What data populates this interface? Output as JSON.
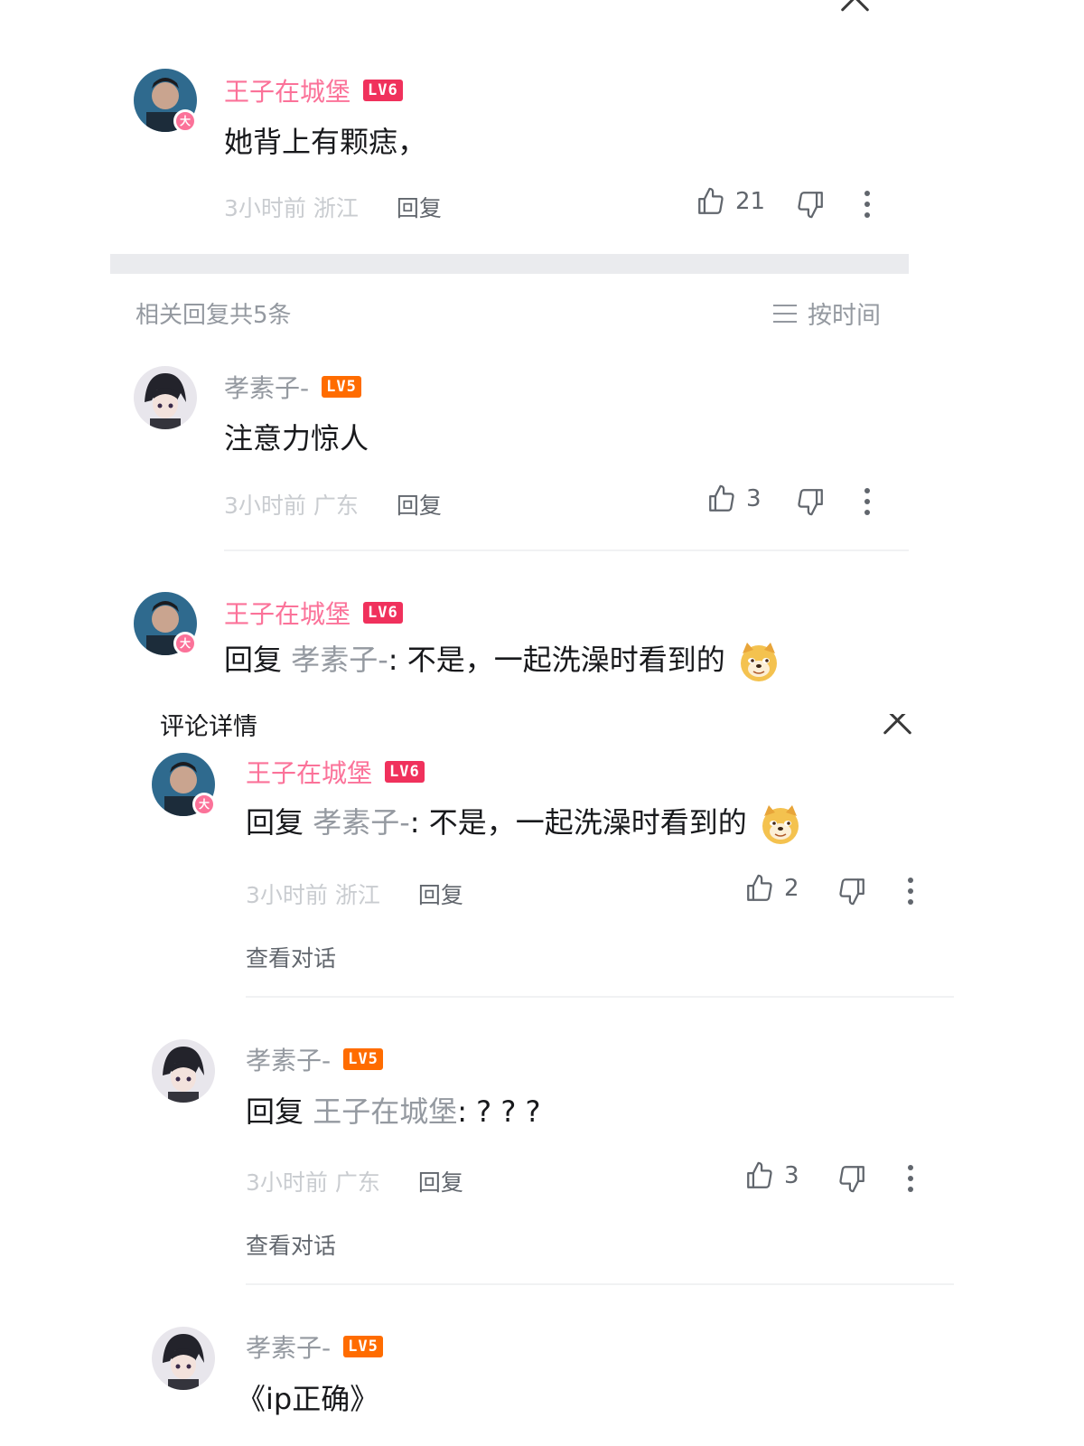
{
  "top_panel": {
    "main_comment": {
      "username": "王子在城堡",
      "level": "LV6",
      "text": "她背上有颗痣，",
      "time": "3小时前",
      "location": "浙江",
      "reply_label": "回复",
      "likes": "21"
    },
    "replies_header": {
      "count_text": "相关回复共5条",
      "sort_label": "按时间"
    },
    "replies": [
      {
        "username": "孝素子-",
        "level": "LV5",
        "text": "注意力惊人",
        "time": "3小时前",
        "location": "广东",
        "reply_label": "回复",
        "likes": "3"
      },
      {
        "username": "王子在城堡",
        "level": "LV6",
        "reply_kw": "回复",
        "at_user": "孝素子-",
        "text": ": 不是，一起洗澡时看到的"
      }
    ]
  },
  "bottom_panel": {
    "title": "评论详情",
    "comments": [
      {
        "username": "王子在城堡",
        "level": "LV6",
        "reply_kw": "回复",
        "at_user": "孝素子-",
        "text": ": 不是，一起洗澡时看到的",
        "time": "3小时前",
        "location": "浙江",
        "reply_label": "回复",
        "likes": "2",
        "view_convo": "查看对话"
      },
      {
        "username": "孝素子-",
        "level": "LV5",
        "reply_kw": "回复",
        "at_user": "王子在城堡",
        "text": ": ? ? ?",
        "time": "3小时前",
        "location": "广东",
        "reply_label": "回复",
        "likes": "3",
        "view_convo": "查看对话"
      },
      {
        "username": "孝素子-",
        "level": "LV5",
        "text": "《ip正确》"
      }
    ]
  },
  "colors": {
    "vip_pink": "#fb7299",
    "lv6": "#f0315c",
    "lv5": "#ff6c00",
    "muted": "#9499a0"
  },
  "icons": [
    "close-icon",
    "thumbs-up-icon",
    "thumbs-down-icon",
    "more-icon",
    "sort-icon",
    "doge-emoji-icon"
  ]
}
